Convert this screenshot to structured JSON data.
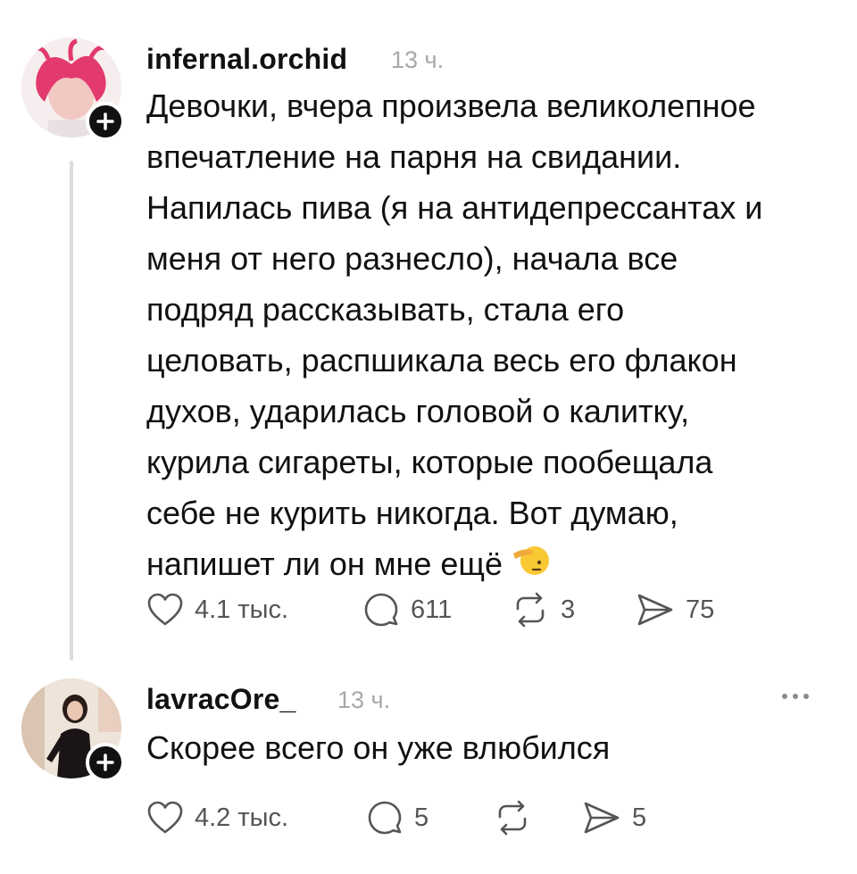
{
  "posts": [
    {
      "username": "infernal.orchid",
      "time": "13 ч.",
      "lines": [
        "Девочки, вчера произвела великолепное",
        "впечатление на парня на свидании.",
        "Напилась пива (я на антидепрессантах и",
        "меня от него разнесло), начала все",
        "подряд рассказывать, стала его",
        "целовать, распшикала весь его флакон",
        "духов, ударилась головой о калитку,",
        "курила сигареты, которые пообещала",
        "себе не курить никогда. Вот думаю,",
        "напишет ли он мне ещё"
      ],
      "emoji": "saluting-face-emoji",
      "likes": "4.1 тыс.",
      "comments": "611",
      "reposts": "3",
      "shares": "75"
    },
    {
      "username": "lavracOre_",
      "time": "13 ч.",
      "lines": [
        "Скорее всего он уже влюбился"
      ],
      "likes": "4.2 тыс.",
      "comments": "5",
      "reposts": "",
      "shares": "5"
    }
  ],
  "icons": {
    "like": "heart-icon",
    "comment": "comment-bubble-icon",
    "repost": "repost-icon",
    "share": "send-icon",
    "more": "more-dots-icon",
    "follow": "plus-icon"
  },
  "colors": {
    "text": "#111111",
    "muted": "#a8a8a8",
    "icon": "#555555",
    "thread_line": "#dcdcdc"
  }
}
